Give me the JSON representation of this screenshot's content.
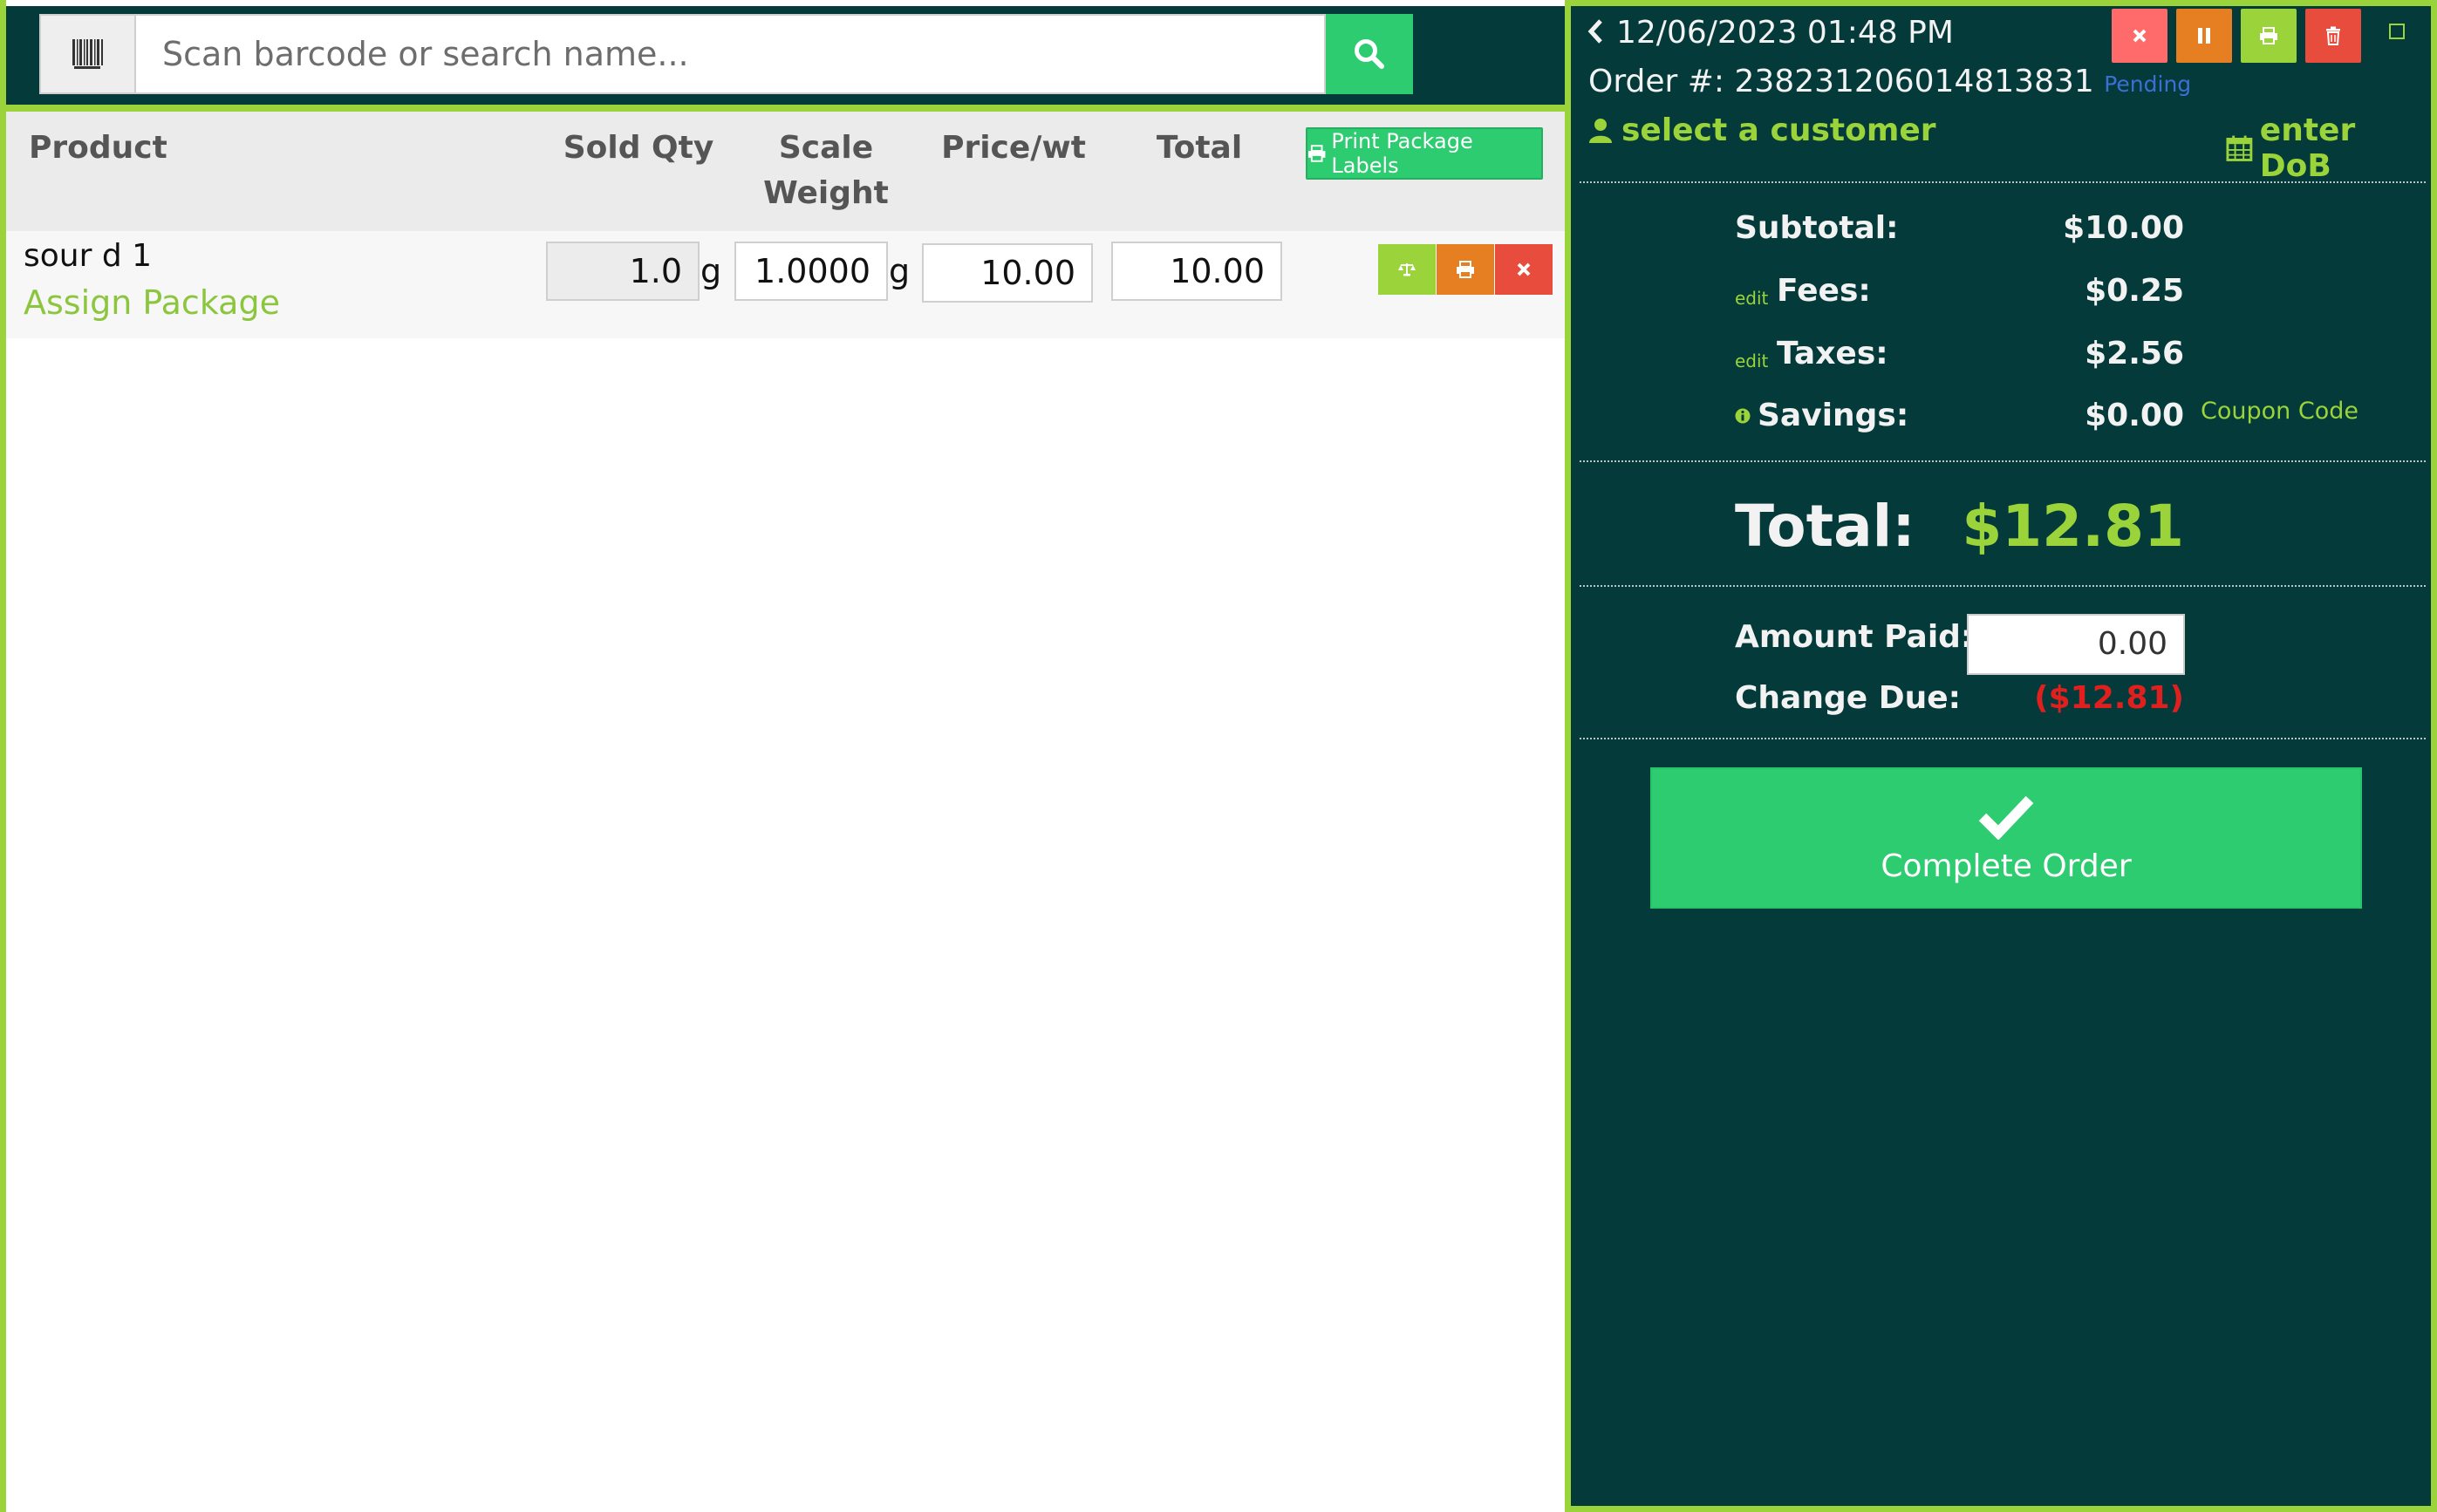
{
  "search": {
    "placeholder": "Scan barcode or search name..."
  },
  "table": {
    "headers": {
      "product": "Product",
      "sold_qty": "Sold Qty",
      "scale_weight_1": "Scale",
      "scale_weight_2": "Weight",
      "price_wt": "Price/wt",
      "total": "Total"
    },
    "print_labels": "Print Package Labels",
    "rows": [
      {
        "product": "sour d 1",
        "assign": "Assign Package",
        "sold_qty": "1.0",
        "qty_unit": "g",
        "scale_weight": "1.0000",
        "weight_unit": "g",
        "price_wt": "10.00",
        "total": "10.00"
      }
    ]
  },
  "order": {
    "datetime": "12/06/2023 01:48 PM",
    "order_label": "Order #:",
    "order_number": "238231206014813831",
    "status": "Pending",
    "customer_link": "select a customer",
    "dob_link": "enter DoB",
    "subtotal_label": "Subtotal:",
    "subtotal": "$10.00",
    "fees_edit": "edit",
    "fees_label": "Fees:",
    "fees": "$0.25",
    "taxes_edit": "edit",
    "taxes_label": "Taxes:",
    "taxes": "$2.56",
    "savings_label": "Savings:",
    "savings": "$0.00",
    "coupon_link": "Coupon Code",
    "total_label": "Total:",
    "total": "$12.81",
    "amount_paid_label": "Amount Paid:",
    "amount_paid": "0.00",
    "change_due_label": "Change Due:",
    "change_due": "($12.81)",
    "complete_label": "Complete Order"
  },
  "icons": {
    "barcode": "barcode-icon",
    "search": "search-icon",
    "print": "print-icon",
    "scale": "scale-icon",
    "close": "close-icon",
    "pause": "pause-icon",
    "trash": "trash-icon",
    "user": "user-icon",
    "calendar": "calendar-icon",
    "info": "info-icon",
    "check": "check-icon",
    "chevron": "chevron-left-icon",
    "expand": "expand-icon"
  },
  "colors": {
    "dark_teal": "#043a3a",
    "lime": "#9ad33a",
    "green": "#2ecc71",
    "orange": "#e67e22",
    "red": "#e74c3c",
    "salmon": "#ff6b6b",
    "blue_status": "#3b6fd6",
    "negative": "#e0201e"
  }
}
